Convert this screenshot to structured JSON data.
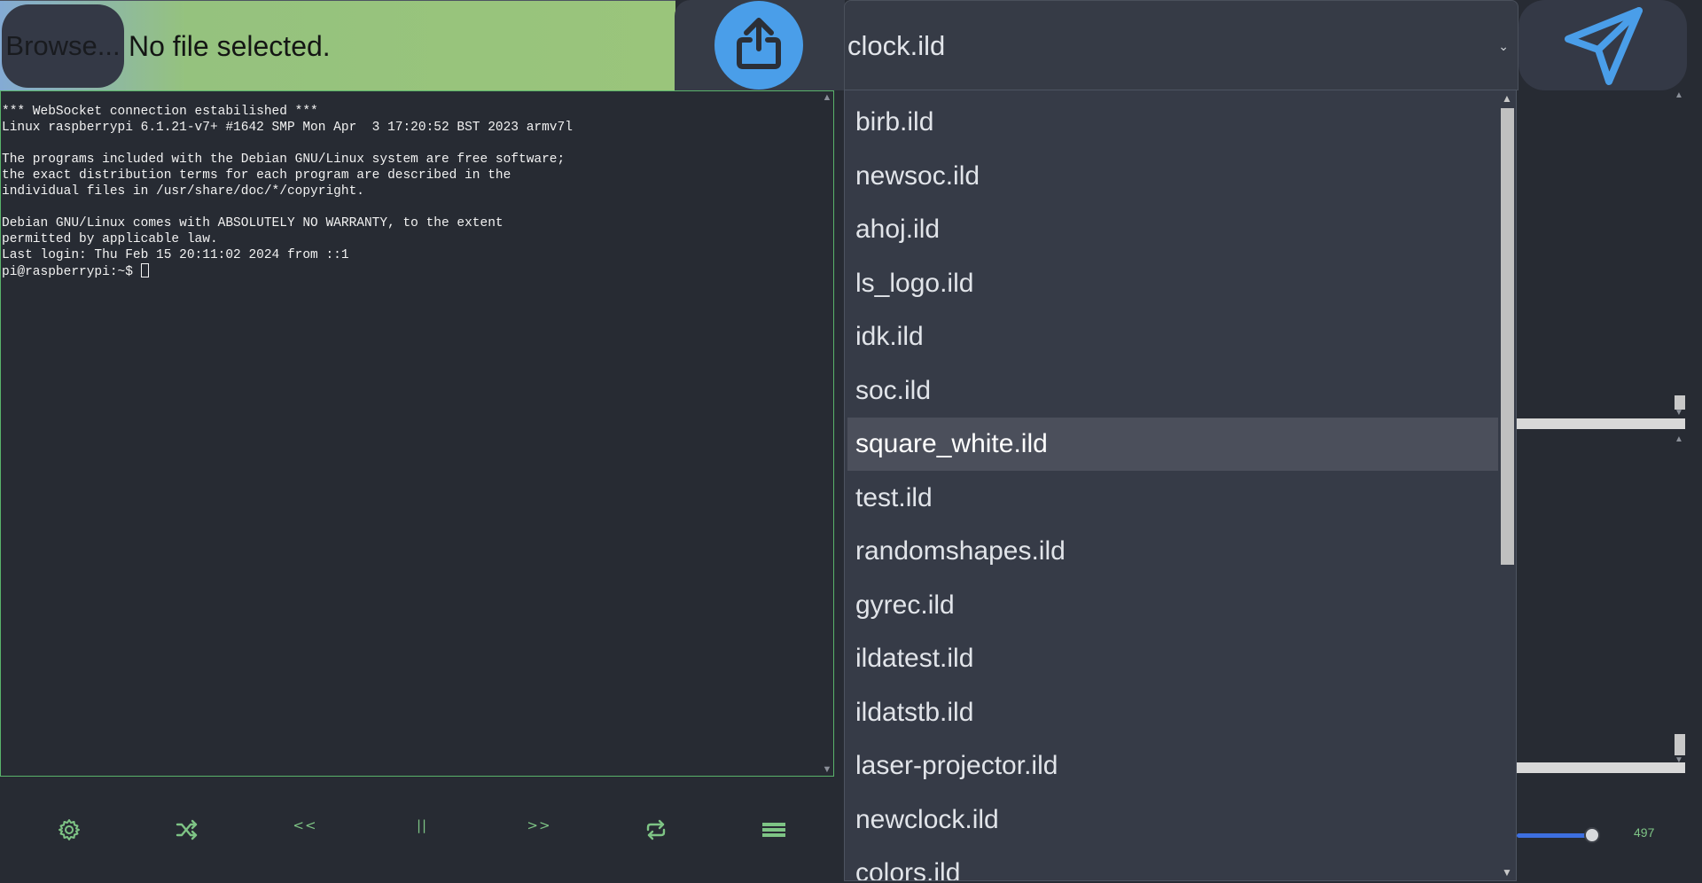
{
  "file_input": {
    "browse_label": "Browse...",
    "status": "No file selected."
  },
  "upload_button": {
    "icon": "upload-icon"
  },
  "file_select": {
    "selected": "clock.ild",
    "arrow": "⌄",
    "options": [
      "birb.ild",
      "newsoc.ild",
      "ahoj.ild",
      "ls_logo.ild",
      "idk.ild",
      "soc.ild",
      "square_white.ild",
      "test.ild",
      "randomshapes.ild",
      "gyrec.ild",
      "ildatest.ild",
      "ildatstb.ild",
      "laser-projector.ild",
      "newclock.ild",
      "colors.ild"
    ],
    "highlighted_index": 6
  },
  "send_button": {
    "icon": "send-icon"
  },
  "terminal": {
    "lines": [
      "*** WebSocket connection estabilished ***",
      "Linux raspberrypi 6.1.21-v7+ #1642 SMP Mon Apr  3 17:20:52 BST 2023 armv7l",
      "",
      "The programs included with the Debian GNU/Linux system are free software;",
      "the exact distribution terms for each program are described in the",
      "individual files in /usr/share/doc/*/copyright.",
      "",
      "Debian GNU/Linux comes with ABSOLUTELY NO WARRANTY, to the extent",
      "permitted by applicable law.",
      "Last login: Thu Feb 15 20:11:02 2024 from ::1"
    ],
    "prompt": "pi@raspberrypi:~$ "
  },
  "controls": {
    "settings_icon": "gear-icon",
    "shuffle_icon": "shuffle-icon",
    "previous_label": "<<",
    "pause_label": "||",
    "next_label": ">>",
    "repeat_icon": "repeat-icon",
    "playlist_icon": "list-icon"
  },
  "slider": {
    "value": "497",
    "fill_fraction": 0.85
  },
  "colors": {
    "accent_green": "#7ec485",
    "accent_blue": "#4a9ee9",
    "background": "#272b33",
    "panel": "#363b46"
  }
}
